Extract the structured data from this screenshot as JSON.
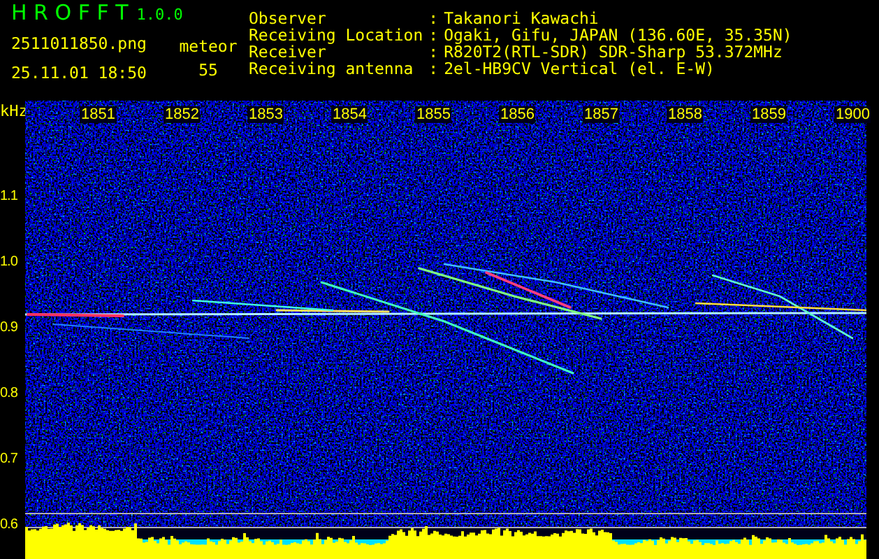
{
  "app": {
    "name": "H R O F F T",
    "version": "1.0.0"
  },
  "file_name": "2511011850.png",
  "timestamp": "25.11.01 18:50",
  "meteor": {
    "label": "meteor",
    "count": "55"
  },
  "station_info": [
    {
      "label": "Observer",
      "separator": ":",
      "value": "Takanori Kawachi"
    },
    {
      "label": "Receiving Location",
      "separator": ":",
      "value": "Ogaki, Gifu, JAPAN (136.60E, 35.35N)"
    },
    {
      "label": "Receiver",
      "separator": ":",
      "value": "R820T2(RTL-SDR) SDR-Sharp 53.372MHz"
    },
    {
      "label": "Receiving antenna",
      "separator": ":",
      "value": "2el-HB9CV Vertical (el. E-W)"
    }
  ],
  "spectrogram": {
    "unit": "kHz",
    "time_labels": [
      "1851",
      "1852",
      "1853",
      "1854",
      "1855",
      "1856",
      "1857",
      "1858",
      "1859",
      "1900"
    ],
    "frequency_labels": [
      "1.1",
      "1.0",
      "0.9",
      "0.8",
      "0.7",
      "0.6"
    ]
  }
}
